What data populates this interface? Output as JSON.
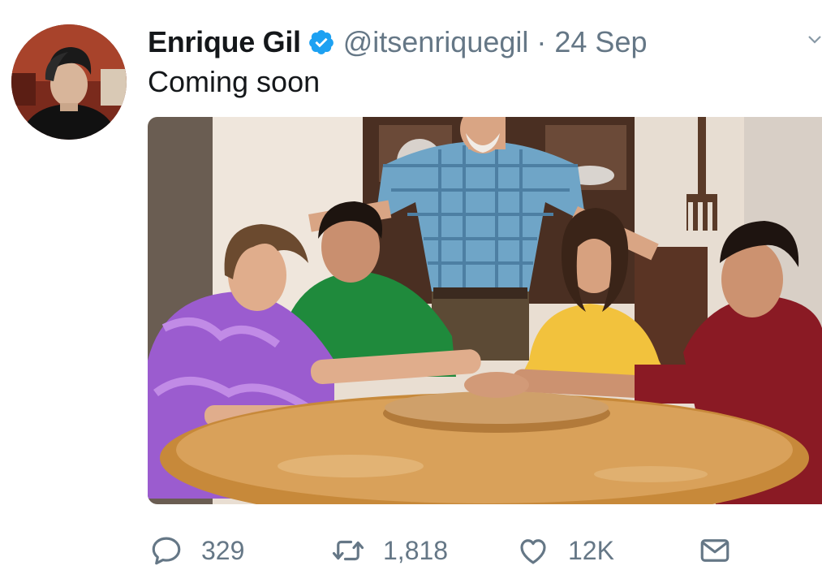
{
  "tweet": {
    "author_name": "Enrique Gil",
    "handle": "@itsenriquegil",
    "separator": "·",
    "timestamp": "24 Sep",
    "text": "Coming soon",
    "verified": true
  },
  "actions": {
    "reply_count": "329",
    "retweet_count": "1,818",
    "like_count": "12K"
  },
  "icons": {
    "reply": "reply-icon",
    "retweet": "retweet-icon",
    "like": "heart-icon",
    "share": "mail-icon",
    "verified": "verified-badge-icon",
    "menu": "chevron-down-icon"
  },
  "colors": {
    "verified_blue": "#1da1f2",
    "muted_text": "#657786",
    "primary_text": "#14171a"
  }
}
